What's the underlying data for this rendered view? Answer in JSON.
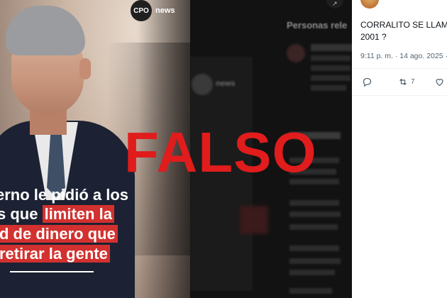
{
  "photo_card": {
    "logo_mark": "CPO",
    "logo_text": "news",
    "caption_lines": [
      {
        "text": "erno le pidió a los",
        "highlight": ""
      },
      {
        "text": "s que ",
        "highlight": "limiten la"
      },
      {
        "text": "",
        "highlight": "d de dinero que"
      },
      {
        "text": "",
        "highlight": "retirar la gente"
      }
    ]
  },
  "background_panel": {
    "logo_mark": "CPO",
    "logo_text": "news",
    "arrow_icon": "diagonal-arrow-icon",
    "section_title": "Personas rele"
  },
  "stamp": {
    "text": "FALSO",
    "color": "#e01c1c"
  },
  "tweet": {
    "text": "CORRALITO SE LLAMA 2001 ?",
    "timestamp": "9:11 p. m. · 14 ago. 2025 ·",
    "actions": [
      {
        "icon": "reply-icon",
        "count": ""
      },
      {
        "icon": "retweet-icon",
        "count": "7"
      },
      {
        "icon": "like-icon",
        "count": ""
      }
    ]
  },
  "colors": {
    "accent_red": "#d2312f",
    "tweet_text": "#0f1419",
    "tweet_meta": "#536471"
  }
}
